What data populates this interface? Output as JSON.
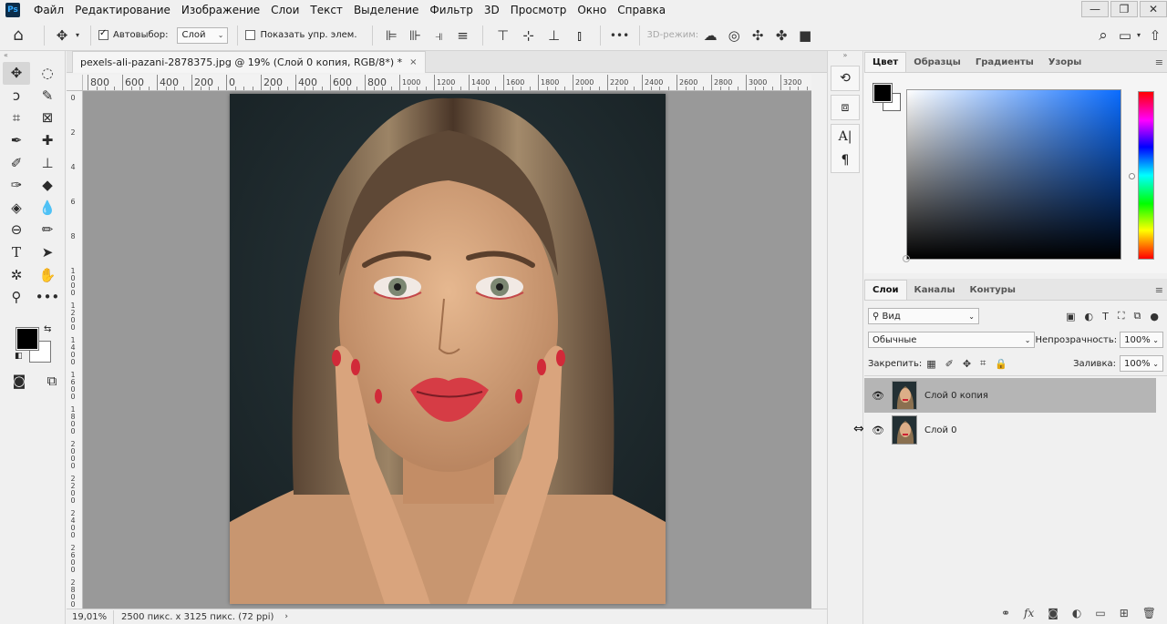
{
  "app": {
    "logo": "Ps"
  },
  "menu": [
    "Файл",
    "Редактирование",
    "Изображение",
    "Слои",
    "Текст",
    "Выделение",
    "Фильтр",
    "3D",
    "Просмотр",
    "Окно",
    "Справка"
  ],
  "window_controls": {
    "minimize": "—",
    "restore": "❐",
    "close": "✕"
  },
  "options": {
    "home_icon": "⌂",
    "move_icon": "✥",
    "autoselect_label": "Автовыбор:",
    "autoselect_value": "Слой",
    "show_transform_label": "Показать упр. элем.",
    "more": "•••",
    "mode_3d_label": "3D-режим:",
    "search_icon": "⌕"
  },
  "document": {
    "tab_title": "pexels-ali-pazani-2878375.jpg @ 19% (Слой 0 копия, RGB/8*) *",
    "tab_close": "×",
    "ruler_h": [
      "800",
      "600",
      "400",
      "200",
      "0",
      "200",
      "400",
      "600",
      "800",
      "1000",
      "1200",
      "1400",
      "1600",
      "1800",
      "2000",
      "2200",
      "2400",
      "2600",
      "2800",
      "3000",
      "3200"
    ],
    "ruler_v": [
      "0",
      "2",
      "4",
      "6",
      "8",
      "1\n0\n0\n0",
      "1\n2\n0\n0",
      "1\n4\n0\n0",
      "1\n6\n0\n0",
      "1\n8\n0\n0",
      "2\n0\n0\n0",
      "2\n2\n0\n0",
      "2\n4\n0\n0",
      "2\n6\n0\n0",
      "2\n8\n0\n0",
      "3\n0\n0\n0"
    ],
    "zoom": "19,01%",
    "info": "2500 пикс. x 3125 пикс. (72 ppi)",
    "status_arrow": "›"
  },
  "color_panel": {
    "tabs": [
      "Цвет",
      "Образцы",
      "Градиенты",
      "Узоры"
    ],
    "foreground": "#000000",
    "background": "#ffffff"
  },
  "layers_panel": {
    "tabs": [
      "Слои",
      "Каналы",
      "Контуры"
    ],
    "filter_label": "Вид",
    "blend_mode": "Обычные",
    "opacity_label": "Непрозрачность:",
    "opacity_value": "100%",
    "lock_label": "Закрепить:",
    "fill_label": "Заливка:",
    "fill_value": "100%",
    "layers": [
      {
        "name": "Слой 0 копия",
        "visible": true,
        "selected": true
      },
      {
        "name": "Слой 0",
        "visible": true,
        "selected": false
      }
    ],
    "footer_icons": [
      "link-icon",
      "fx-icon",
      "mask-icon",
      "adjustment-icon",
      "group-icon",
      "new-layer-icon",
      "trash-icon"
    ]
  }
}
